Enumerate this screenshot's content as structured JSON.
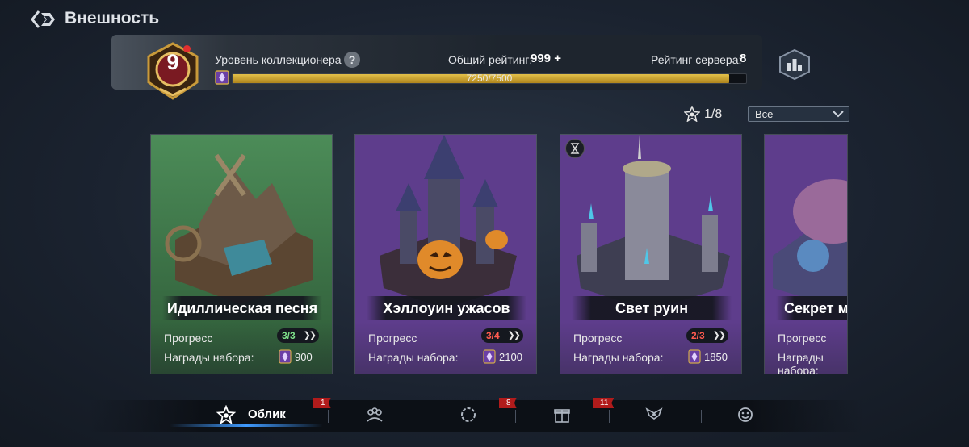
{
  "header": {
    "title": "Внешность"
  },
  "collector": {
    "level": "9",
    "label": "Уровень коллекционера",
    "help": "?",
    "total_rating_label": "Общий рейтинг:",
    "total_rating_value": "999 +",
    "server_rating_label": "Рейтинг сервера:",
    "server_rating_value": "8",
    "xp_text": "7250/7500",
    "xp_current": 7250,
    "xp_max": 7500
  },
  "filter": {
    "counter": "1/8",
    "selected": "Все"
  },
  "cards": [
    {
      "title": "Идиллическая песня",
      "progress_label": "Прогресс",
      "progress": "3/3",
      "progress_color": "#7ee08a",
      "rewards_label": "Награды набора:",
      "reward": "900",
      "bg": "#3f7a4c"
    },
    {
      "title": "Хэллоуин ужасов",
      "progress_label": "Прогресс",
      "progress": "3/4",
      "progress_color": "#ff5b4f",
      "rewards_label": "Награды набора:",
      "reward": "2100",
      "bg": "#5e3d8c"
    },
    {
      "title": "Свет руин",
      "progress_label": "Прогресс",
      "progress": "2/3",
      "progress_color": "#ff5b4f",
      "rewards_label": "Награды набора:",
      "reward": "1850",
      "bg": "#5e3d8c"
    },
    {
      "title": "Секрет мор",
      "progress_label": "Прогресс",
      "progress": "",
      "progress_color": "#ff5b4f",
      "rewards_label": "Награды набора:",
      "reward": "",
      "bg": "#5e3d8c"
    }
  ],
  "nav": {
    "active_label": "Облик",
    "badges": [
      "1",
      "8",
      "11"
    ],
    "icons": [
      "star-icon",
      "crowd-icon",
      "wreath-icon",
      "gift-icon",
      "wings-icon",
      "emote-icon"
    ]
  },
  "colors": {
    "accent": "#3f9aff",
    "xp_fill": "#d6b03a",
    "badge": "#b11b1b",
    "green_card": "#3f7a4c",
    "purple_card": "#5e3d8c"
  }
}
